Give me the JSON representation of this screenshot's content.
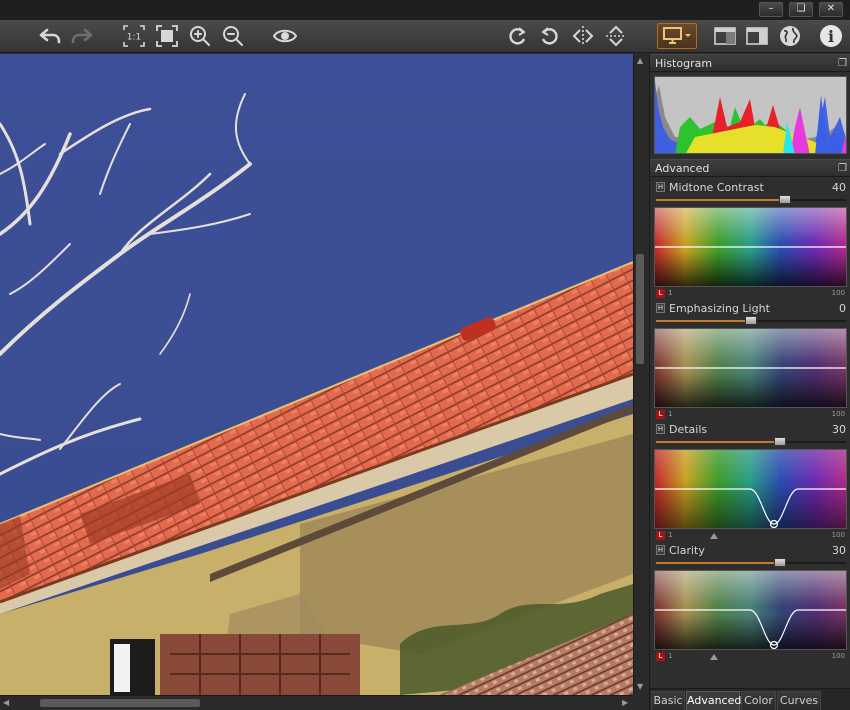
{
  "window": {
    "min_glyph": "–",
    "restore_glyph": "❏",
    "close_glyph": "✕"
  },
  "toolbar": {
    "icons": [
      "undo-icon",
      "redo-icon",
      "actual-size-icon",
      "fit-to-window-icon",
      "zoom-in-icon",
      "zoom-out-icon",
      "preview-eye-icon",
      "rotate-clockwise-icon",
      "rotate-counterclockwise-icon",
      "flip-horizontal-icon",
      "flip-vertical-icon",
      "monitor-icon",
      "single-view-icon",
      "split-view-icon",
      "globe-icon",
      "info-icon"
    ],
    "actual_size_label": "1:1",
    "info_glyph": "i",
    "monitor_accent": "#c77a2a"
  },
  "panel": {
    "histogram": {
      "title": "Histogram",
      "colors": {
        "red": "#e8202a",
        "green": "#2ec22e",
        "blue": "#3a5ee6",
        "yellow": "#e6e02a",
        "magenta": "#e63ae0",
        "cyan": "#2ae6e6",
        "gray": "#8a8a8a"
      }
    },
    "advanced": {
      "title": "Advanced",
      "controls": [
        {
          "h": "H",
          "label": "Midtone Contrast",
          "value": "40",
          "level": 0.68,
          "scale_lo": "1",
          "scale_hi": "100",
          "l": "L"
        },
        {
          "h": "H",
          "label": "Emphasizing Light",
          "value": "0",
          "level": 0.5,
          "scale_lo": "1",
          "scale_hi": "100",
          "l": "L"
        },
        {
          "h": "H",
          "label": "Details",
          "value": "30",
          "level": 0.65,
          "scale_lo": "1",
          "scale_hi": "100",
          "l": "L"
        },
        {
          "h": "H",
          "label": "Clarity",
          "value": "30",
          "level": 0.65,
          "scale_lo": "1",
          "scale_hi": "100",
          "l": "L"
        }
      ]
    },
    "tabs": [
      "Basic",
      "Advanced",
      "Color",
      "Curves"
    ],
    "active_tab": "Advanced"
  },
  "scrollbars": {
    "up": "▲",
    "down": "▼",
    "left": "◀",
    "right": "▶"
  }
}
